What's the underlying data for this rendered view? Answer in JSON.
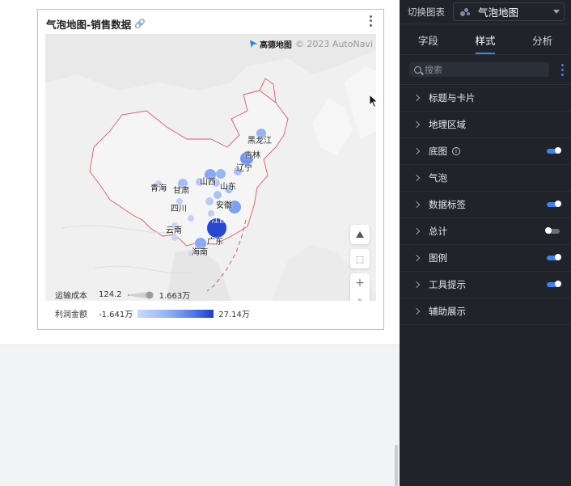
{
  "card": {
    "title": "气泡地图-销售数据"
  },
  "map": {
    "attribution_brand": "高德地图",
    "attribution_copyright": "© 2023 AutoNavi",
    "provinces": [
      {
        "name": "黑龙江",
        "inverse": false
      },
      {
        "name": "吉林",
        "inverse": false
      },
      {
        "name": "辽宁",
        "inverse": false
      },
      {
        "name": "山西",
        "inverse": false
      },
      {
        "name": "山东",
        "inverse": false
      },
      {
        "name": "青海",
        "inverse": false
      },
      {
        "name": "甘肃",
        "inverse": false
      },
      {
        "name": "安徽",
        "inverse": false
      },
      {
        "name": "四川",
        "inverse": false
      },
      {
        "name": "江西",
        "inverse": true
      },
      {
        "name": "云南",
        "inverse": false
      },
      {
        "name": "广东",
        "inverse": false
      },
      {
        "name": "海南",
        "inverse": false
      }
    ],
    "bubble_color": "#7da3f0",
    "highlight_color": "#2747d0"
  },
  "legend": {
    "size_title": "运输成本",
    "size_min": "124.2",
    "size_max": "1.663万",
    "color_title": "利润金额",
    "color_min": "-1.641万",
    "color_max": "27.14万"
  },
  "panel": {
    "switch_label": "切换图表",
    "chart_type": "气泡地图",
    "tabs": [
      {
        "label": "字段",
        "active": false
      },
      {
        "label": "样式",
        "active": true
      },
      {
        "label": "分析",
        "active": false
      }
    ],
    "search_placeholder": "搜索",
    "sections": [
      {
        "label": "标题与卡片",
        "toggle": null,
        "info": false
      },
      {
        "label": "地理区域",
        "toggle": null,
        "info": false
      },
      {
        "label": "底图",
        "toggle": "on",
        "info": true
      },
      {
        "label": "气泡",
        "toggle": null,
        "info": false
      },
      {
        "label": "数据标签",
        "toggle": "on",
        "info": false
      },
      {
        "label": "总计",
        "toggle": "off",
        "info": false
      },
      {
        "label": "图例",
        "toggle": "on",
        "info": false
      },
      {
        "label": "工具提示",
        "toggle": "on",
        "info": false
      },
      {
        "label": "辅助展示",
        "toggle": null,
        "info": false
      }
    ]
  }
}
